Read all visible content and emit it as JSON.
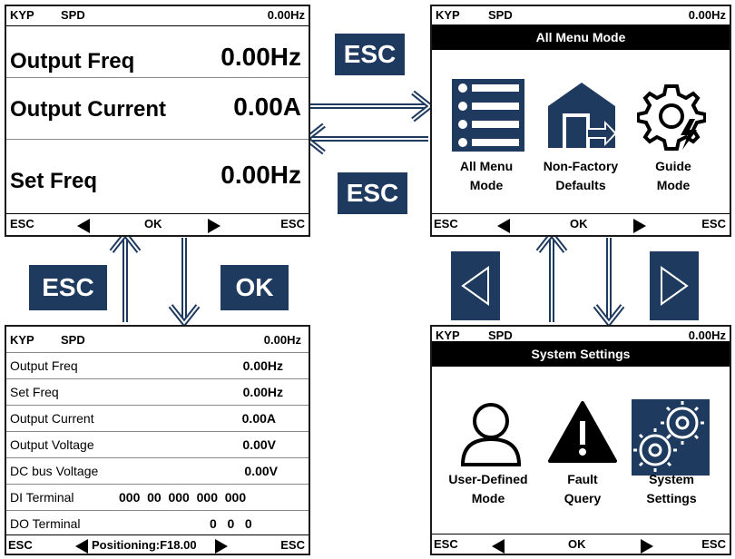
{
  "status": {
    "kyp": "KYP",
    "spd": "SPD",
    "freq": "0.00Hz"
  },
  "main_screen": {
    "rows": [
      {
        "label": "Output  Freq",
        "value": "0.00Hz"
      },
      {
        "label": "Output  Current",
        "value": "0.00A"
      },
      {
        "label": "Set  Freq",
        "value": "0.00Hz"
      }
    ],
    "bottom": {
      "left": "ESC",
      "ok": "OK",
      "right": "ESC"
    }
  },
  "menu_screen": {
    "title": "All Menu Mode",
    "items": [
      {
        "caption_l1": "All  Menu",
        "caption_l2": "Mode",
        "icon": "list-icon"
      },
      {
        "caption_l1": "Non-Factory",
        "caption_l2": "Defaults",
        "icon": "factory-icon"
      },
      {
        "caption_l1": "Guide",
        "caption_l2": "Mode",
        "icon": "gear-bolt-icon"
      }
    ],
    "bottom": {
      "left": "ESC",
      "ok": "OK",
      "right": "ESC"
    }
  },
  "list_screen": {
    "rows": [
      {
        "label": "Output Freq",
        "value": "0.00Hz"
      },
      {
        "label": "Set  Freq",
        "value": "0.00Hz"
      },
      {
        "label": "Output Current",
        "value": "0.00A"
      },
      {
        "label": "Output Voltage",
        "value": "0.00V"
      },
      {
        "label": "DC  bus  Voltage",
        "value": "0.00V"
      },
      {
        "label": "DI  Terminal",
        "value": "000  00  000  000  000"
      },
      {
        "label": "DO  Terminal",
        "value": "0   0   0"
      }
    ],
    "bottom": {
      "left": "ESC",
      "center": "Positioning:F18.00",
      "right": "ESC"
    }
  },
  "settings_screen": {
    "title": "System  Settings",
    "items": [
      {
        "caption_l1": "User-Defined",
        "caption_l2": "Mode",
        "icon": "user-icon"
      },
      {
        "caption_l1": "Fault",
        "caption_l2": "Query",
        "icon": "warning-icon"
      },
      {
        "caption_l1": "System",
        "caption_l2": "Settings",
        "icon": "gears-icon"
      }
    ],
    "bottom": {
      "left": "ESC",
      "ok": "OK",
      "right": "ESC"
    }
  },
  "tags": {
    "esc_top": "ESC",
    "esc_mid": "ESC",
    "esc_left": "ESC",
    "ok_left": "OK"
  },
  "colors": {
    "tag": "#1f3a5f",
    "icon_blue": "#1f3a5f",
    "arrow": "#1f3a5f"
  }
}
